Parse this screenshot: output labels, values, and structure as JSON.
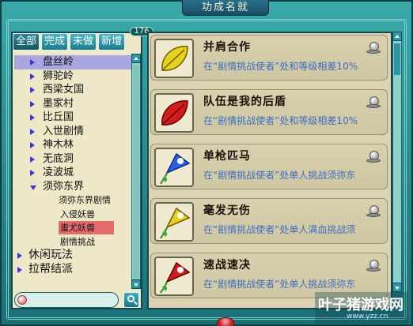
{
  "window": {
    "title": "功成名就"
  },
  "tabs": [
    {
      "label": "全部",
      "active": true
    },
    {
      "label": "完成"
    },
    {
      "label": "未做"
    },
    {
      "label": "新增"
    }
  ],
  "new_count": "176",
  "tree": [
    {
      "label": "盘丝岭",
      "level": 1,
      "expand": "right",
      "selected": true
    },
    {
      "label": "狮驼岭",
      "level": 1,
      "expand": "right"
    },
    {
      "label": "西梁女国",
      "level": 1,
      "expand": "right"
    },
    {
      "label": "墨家村",
      "level": 1,
      "expand": "right"
    },
    {
      "label": "比丘国",
      "level": 1,
      "expand": "right"
    },
    {
      "label": "入世剧情",
      "level": 1,
      "expand": "right"
    },
    {
      "label": "神木林",
      "level": 1,
      "expand": "right"
    },
    {
      "label": "无底洞",
      "level": 1,
      "expand": "right"
    },
    {
      "label": "凌波城",
      "level": 1,
      "expand": "right"
    },
    {
      "label": "须弥东界",
      "level": 1,
      "expand": "down"
    },
    {
      "label": "须弥东界剧情",
      "level": 2
    },
    {
      "label": "入侵妖兽",
      "level": 2
    },
    {
      "label": "蚩尤妖兽",
      "level": 2,
      "selected": true
    },
    {
      "label": "剧情挑战",
      "level": 2
    },
    {
      "label": "休闲玩法",
      "level": 0,
      "expand": "right"
    },
    {
      "label": "拉帮结派",
      "level": 0,
      "expand": "right"
    }
  ],
  "achievements": [
    {
      "title": "并肩合作",
      "desc": "在“剧情挑战使者”处和等级相差10%",
      "icon": "leaf-icon",
      "color": "#e6d21a"
    },
    {
      "title": "队伍是我的后盾",
      "desc": "在“剧情挑战使者”处和等级相差10%",
      "icon": "leaf-icon",
      "color": "#d41c1c"
    },
    {
      "title": "单枪匹马",
      "desc": "在“剧情挑战使者”处单人挑战须弥东",
      "icon": "morning-glory-icon",
      "color": "#2a5fe0"
    },
    {
      "title": "毫发无伤",
      "desc": "在“剧情挑战使者”处单人满血挑战须",
      "icon": "morning-glory-icon",
      "color": "#e6d21a"
    },
    {
      "title": "速战速决",
      "desc": "在“剧情挑战使者”处单人挑战须弥东",
      "icon": "morning-glory-icon",
      "color": "#d41c1c"
    }
  ],
  "watermark": {
    "title": "叶子猪游戏网",
    "url": "www.yzz.cn"
  }
}
